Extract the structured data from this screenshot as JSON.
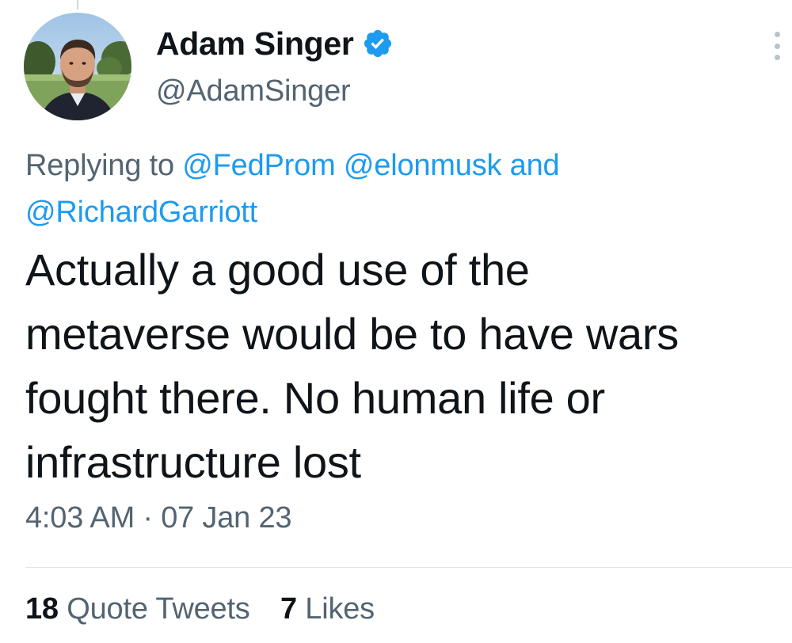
{
  "author": {
    "display_name": "Adam Singer",
    "handle": "@AdamSinger",
    "verified": true,
    "avatar_icon": "profile-photo-avatar"
  },
  "reply": {
    "prefix": "Replying to",
    "mentions": [
      "@FedProm",
      "@elonmusk"
    ],
    "conjunction": "and",
    "last_mention": "@RichardGarriott"
  },
  "tweet": {
    "lines": [
      "Actually a good use of the",
      "metaverse would be to have wars",
      "fought there. No human life or",
      "infrastructure lost"
    ],
    "timestamp": "4:03 AM · 07 Jan 23"
  },
  "stats": {
    "quote_tweets_count": "18",
    "quote_tweets_label": "Quote Tweets",
    "likes_count": "7",
    "likes_label": "Likes"
  },
  "colors": {
    "accent": "#1d9bf0",
    "text_primary": "#0f1419",
    "text_secondary": "#536471"
  },
  "icons": {
    "verified": "verified-badge-icon",
    "more": "more-options-icon"
  }
}
